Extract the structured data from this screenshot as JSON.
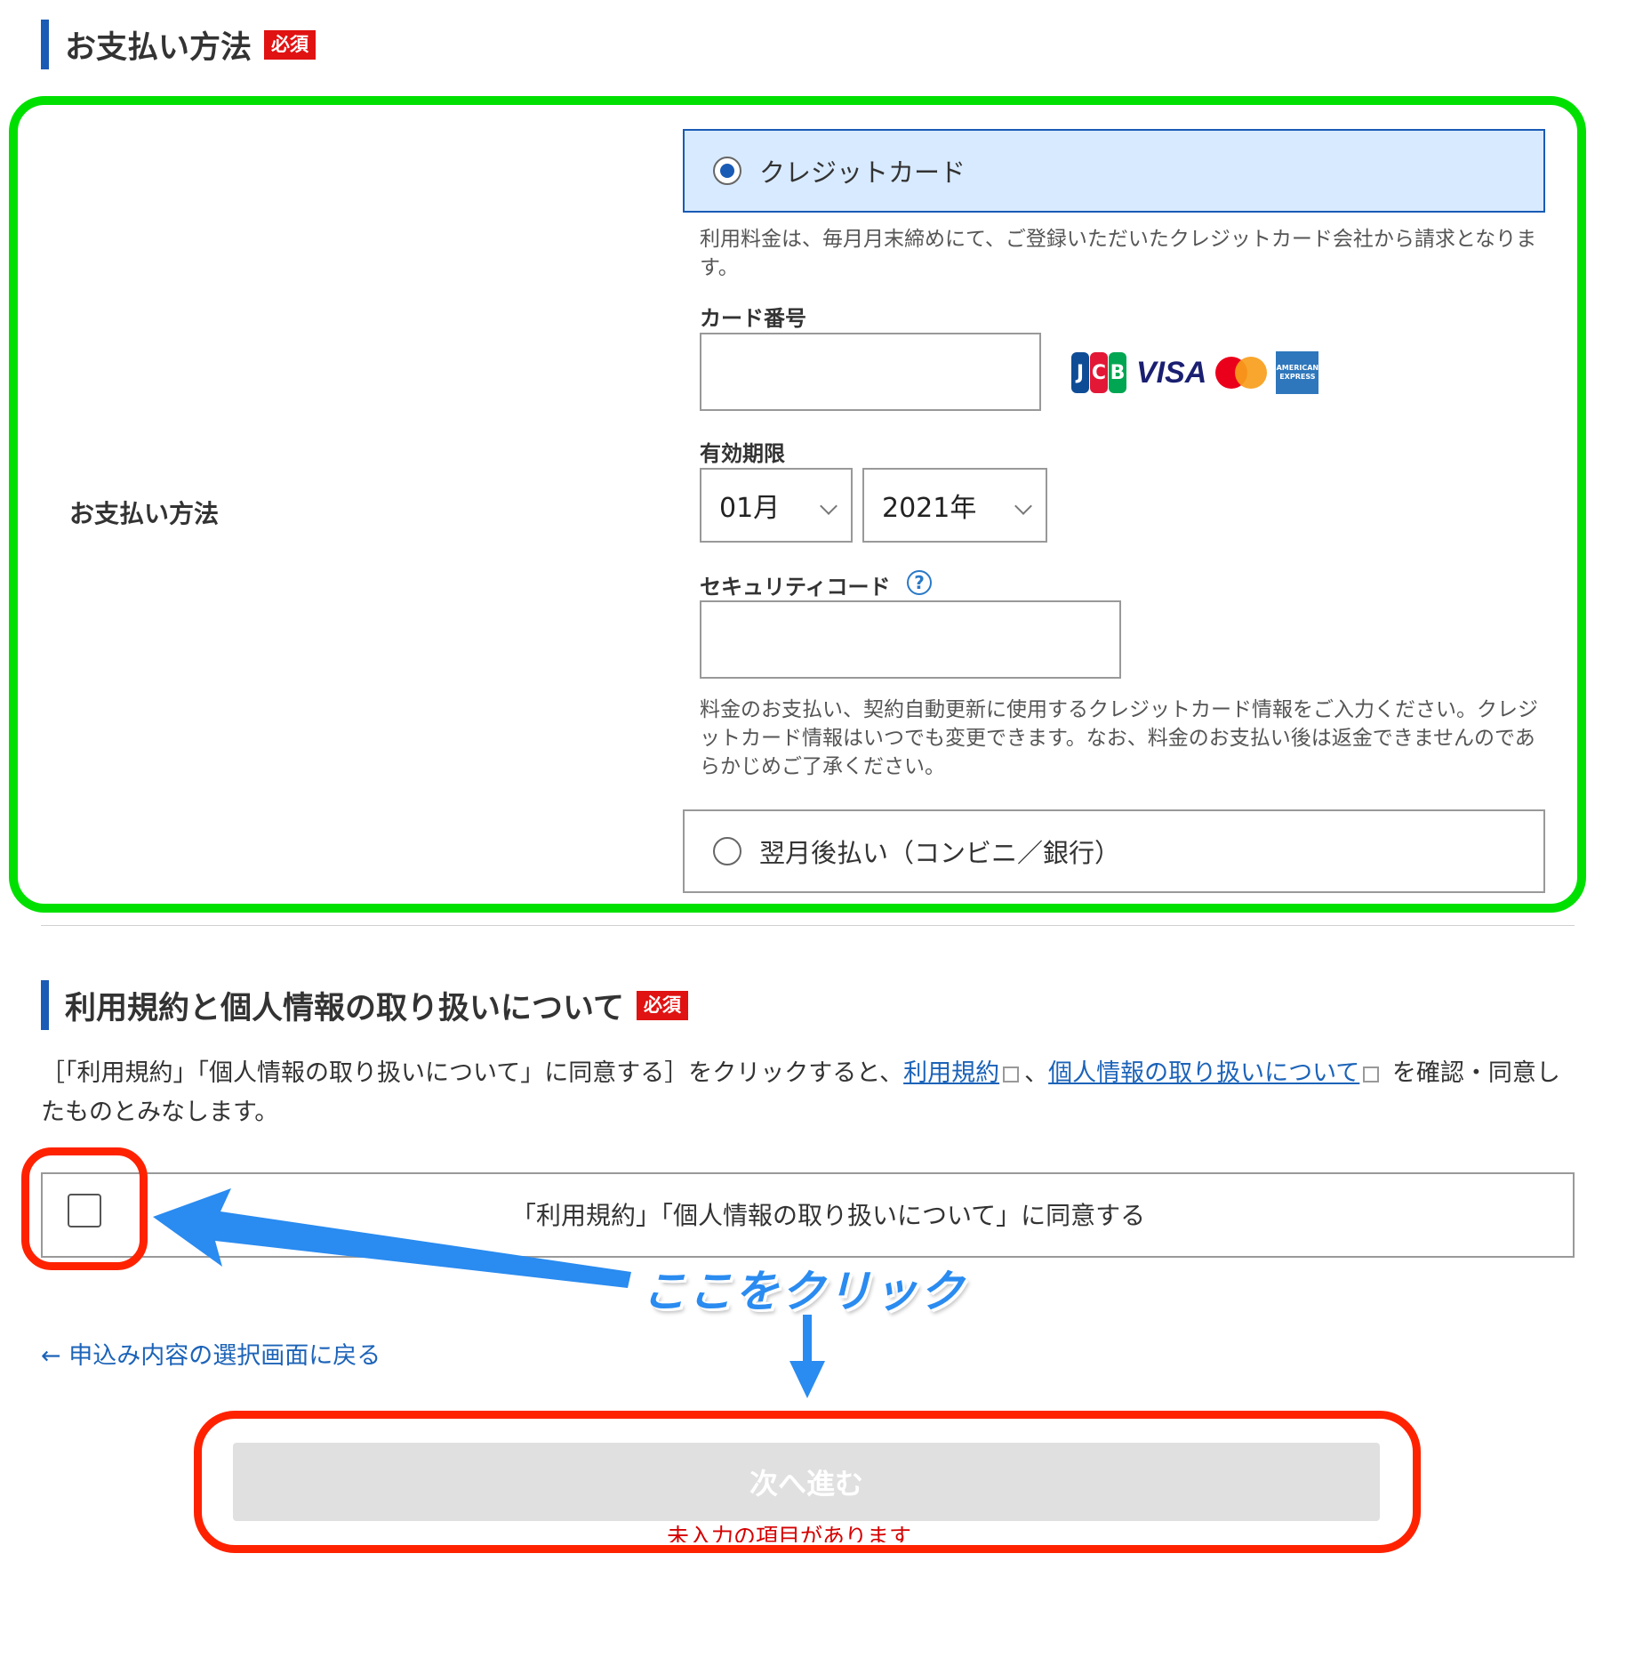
{
  "payment_section": {
    "title": "お支払い方法",
    "required_badge": "必須",
    "row_label": "お支払い方法",
    "credit_card_option": "クレジットカード",
    "credit_note": "利用料金は、毎月月末締めにて、ご登録いただいたクレジットカード会社から請求となります。",
    "card_number_label": "カード番号",
    "card_number_value": "",
    "brands": [
      "JCB",
      "VISA",
      "Mastercard",
      "AMERICAN EXPRESS"
    ],
    "expiry_label": "有効期限",
    "expiry_month": "01月",
    "expiry_year": "2021年",
    "security_code_label": "セキュリティコード",
    "help_icon": "?",
    "security_code_value": "",
    "card_info_note": "料金のお支払い、契約自動更新に使用するクレジットカード情報をご入力ください。クレジットカード情報はいつでも変更できます。なお、料金のお支払い後は返金できませんのであらかじめご了承ください。",
    "deferred_option": "翌月後払い（コンビニ／銀行）"
  },
  "terms_section": {
    "title": "利用規約と個人情報の取り扱いについて",
    "required_badge": "必須",
    "text_before": "［「利用規約」「個人情報の取り扱いについて」に同意する］をクリックすると、",
    "link_terms": "利用規約",
    "separator": "、",
    "link_privacy": "個人情報の取り扱いについて",
    "text_after": " を確認・同意したものとみなします。",
    "agree_label": "「利用規約」「個人情報の取り扱いについて」に同意する",
    "agree_checked": false
  },
  "back_link": "← 申込み内容の選択画面に戻る",
  "next_button": "次へ進む",
  "error_message": "未入力の項目があります",
  "annotation": {
    "click_here": "ここをクリック",
    "highlight_color": "#00e000",
    "alert_color": "#ff2200",
    "arrow_color": "#2a8bf0"
  },
  "colors": {
    "accent": "#1a5bb5",
    "link": "#1c63b8",
    "required": "#e01212",
    "selected_bg": "#d8eaff",
    "disabled_button": "#e0e0e0"
  }
}
